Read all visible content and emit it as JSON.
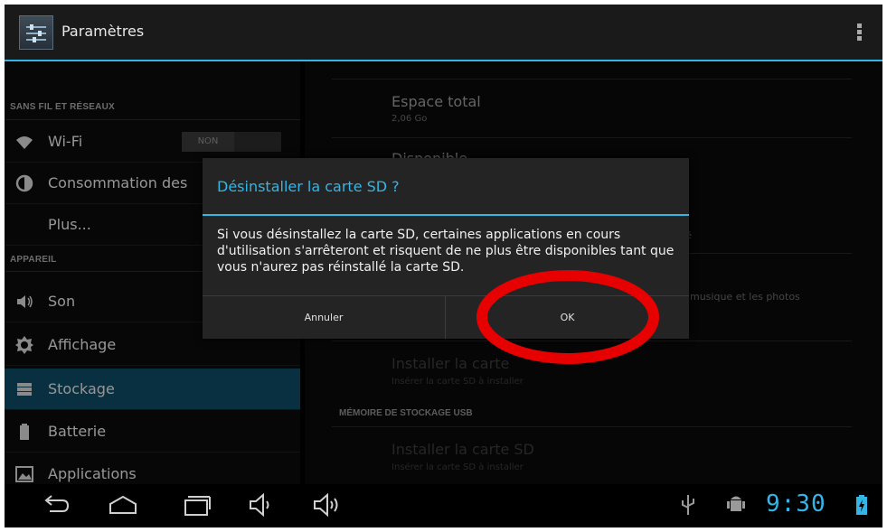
{
  "action_bar": {
    "title": "Paramètres"
  },
  "sidebar": {
    "section_wireless": "SANS FIL ET RÉSEAUX",
    "section_device": "APPAREIL",
    "items": [
      {
        "label": "Wi-Fi",
        "icon": "wifi-icon"
      },
      {
        "label": "Consommation des",
        "icon": "data-usage-icon"
      },
      {
        "label": "Plus...",
        "icon": ""
      },
      {
        "label": "Son",
        "icon": "sound-icon"
      },
      {
        "label": "Affichage",
        "icon": "display-icon"
      },
      {
        "label": "Stockage",
        "icon": "storage-icon"
      },
      {
        "label": "Batterie",
        "icon": "battery-icon"
      },
      {
        "label": "Applications",
        "icon": "applications-icon"
      }
    ],
    "wifi_toggle": "NON"
  },
  "detail": {
    "total_title": "Espace total",
    "total_value": "2,06 Go",
    "available_title": "Disponible",
    "partial_right_1": "é",
    "partial_right_2": "musique et les photos",
    "install_sd_title": "Installer la carte",
    "install_sd_sub": "Insérer la carte SD à installer",
    "usb_header": "MÉMOIRE DE STOCKAGE USB",
    "usb_install_title": "Installer la carte SD",
    "usb_install_sub": "Insérer la carte SD à installer"
  },
  "dialog": {
    "title": "Désinstaller la carte SD ?",
    "message": "Si vous désinstallez la carte SD, certaines applications en cours d'utilisation s'arrêteront et risquent de ne plus être disponibles tant que vous n'aurez pas réinstallé la carte SD.",
    "cancel_label": "Annuler",
    "ok_label": "OK"
  },
  "annotation": {
    "color": "#e60000"
  },
  "navbar": {
    "time": "9:30"
  },
  "colors": {
    "accent": "#33b5e5",
    "active_item": "#0d4a63"
  }
}
